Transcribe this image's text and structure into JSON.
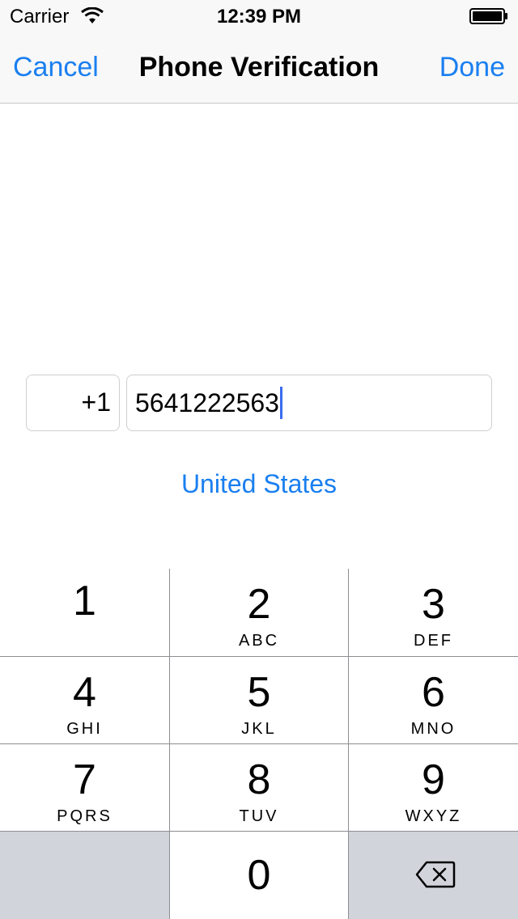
{
  "status_bar": {
    "carrier": "Carrier",
    "time": "12:39 PM"
  },
  "nav": {
    "cancel_label": "Cancel",
    "title": "Phone Verification",
    "done_label": "Done"
  },
  "phone": {
    "country_code": "+1",
    "number": "5641222563",
    "country": "United States"
  },
  "keypad": {
    "keys": [
      {
        "digit": "1",
        "letters": ""
      },
      {
        "digit": "2",
        "letters": "ABC"
      },
      {
        "digit": "3",
        "letters": "DEF"
      },
      {
        "digit": "4",
        "letters": "GHI"
      },
      {
        "digit": "5",
        "letters": "JKL"
      },
      {
        "digit": "6",
        "letters": "MNO"
      },
      {
        "digit": "7",
        "letters": "PQRS"
      },
      {
        "digit": "8",
        "letters": "TUV"
      },
      {
        "digit": "9",
        "letters": "WXYZ"
      },
      {
        "digit": "0",
        "letters": ""
      }
    ],
    "delete_icon": "backspace-icon"
  },
  "colors": {
    "accent": "#1a7ff0",
    "caret": "#3b6cf0",
    "keypad_gray": "#d1d5db"
  }
}
